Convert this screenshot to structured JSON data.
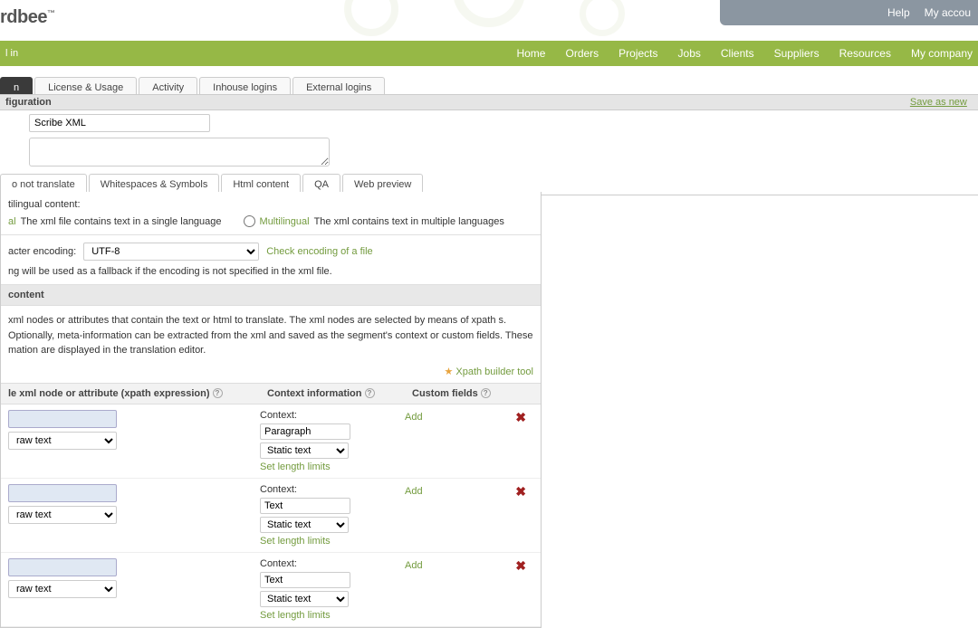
{
  "topbar": {
    "help": "Help",
    "account": "My accou"
  },
  "logo": "rdbee",
  "nav": {
    "left": "l in",
    "items": [
      "Home",
      "Orders",
      "Projects",
      "Jobs",
      "Clients",
      "Suppliers",
      "Resources",
      "My company"
    ]
  },
  "tabs": {
    "active": "n",
    "items": [
      "License & Usage",
      "Activity",
      "Inhouse logins",
      "External logins"
    ]
  },
  "header": {
    "left": "figuration",
    "save": "Save as new"
  },
  "config": {
    "name": "Scribe XML",
    "description": ""
  },
  "subtabs": [
    "o not translate",
    "Whitespaces & Symbols",
    "Html content",
    "QA",
    "Web preview"
  ],
  "multilingual": {
    "title": "tilingual content:",
    "opt1_label": "al",
    "opt1_desc": "The xml file contains text in a single language",
    "opt2_label": "Multilingual",
    "opt2_desc": "The xml contains text in multiple languages"
  },
  "encoding": {
    "label": "acter encoding:",
    "value": "UTF-8",
    "check": "Check encoding of a file",
    "note": "ng will be used as a fallback if the encoding is not specified in the xml file."
  },
  "content": {
    "header": "content",
    "desc": " xml nodes or attributes that contain the text or html to translate. The xml nodes are selected by means of xpath s. Optionally, meta-information can be extracted from the xml and saved as the segment's context or custom fields. These mation are displayed in the translation editor.",
    "xpath_tool": "Xpath builder tool",
    "cols": {
      "c1": "le xml node or attribute (xpath expression)",
      "c2": "Context information",
      "c3": "Custom fields"
    },
    "rows": [
      {
        "raw": "raw text",
        "ctx_label": "Context:",
        "ctx_value": "Paragraph",
        "ctx_type": "Static text",
        "limits": "Set length limits",
        "add": "Add"
      },
      {
        "raw": "raw text",
        "ctx_label": "Context:",
        "ctx_value": "Text",
        "ctx_type": "Static text",
        "limits": "Set length limits",
        "add": "Add"
      },
      {
        "raw": "raw text",
        "ctx_label": "Context:",
        "ctx_value": "Text",
        "ctx_type": "Static text",
        "limits": "Set length limits",
        "add": "Add"
      }
    ]
  }
}
